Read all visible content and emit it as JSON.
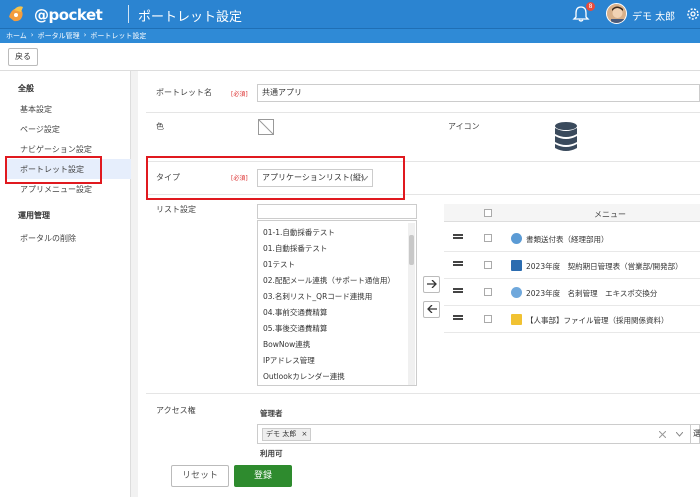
{
  "header": {
    "logo_text": "@pocket",
    "title": "ポートレット設定",
    "notification_count": "8",
    "user_name": "デモ 太郎",
    "colors": {
      "header": "#2b84d1",
      "accent_red": "#e0191f",
      "submit": "#2e8b2e"
    }
  },
  "breadcrumb": [
    "ホーム",
    "›",
    "ポータル管理",
    "›",
    "ポートレット設定"
  ],
  "toolbar": {
    "back_label": "戻る"
  },
  "sidebar": {
    "section1": "全般",
    "items1": [
      "基本設定",
      "ページ設定",
      "ナビゲーション設定",
      "ポートレット設定",
      "アプリメニュー設定"
    ],
    "section2": "運用管理",
    "items2": [
      "ポータルの削除"
    ]
  },
  "form": {
    "portlet_name_label": "ポートレット名",
    "required": "[必須]",
    "portlet_name_value": "共通アプリ",
    "color_label": "色",
    "icon_label": "アイコン",
    "type_label": "タイプ",
    "type_value": "アプリケーションリスト(縦)",
    "list_setting_label": "リスト設定",
    "access_label": "アクセス権",
    "admin_label": "管理者",
    "admin_tag": "デモ 太郎",
    "admin_tag_remove": "×",
    "usable_label": "利用可",
    "select_button_partial": "選"
  },
  "list_items": [
    "01-1.自動採番テスト",
    "01.自動採番テスト",
    "01テスト",
    "02.配配メール連携（サポート通信用）",
    "03.名刺リスト_QRコード連携用",
    "04.事前交通費精算",
    "05.事後交通費精算",
    "BowNow連携",
    "IPアドレス管理",
    "Outlookカレンダー連携"
  ],
  "menu_table": {
    "header": "メニュー",
    "rows": [
      {
        "text": "書類送付表（経理部用）",
        "icon": "globe-icon"
      },
      {
        "text": "2023年度　契約期日管理表（営業部/開発部）",
        "icon": "calendar-icon"
      },
      {
        "text": "2023年度　名刺管理　エキスポ交換分",
        "icon": "cloud-icon"
      },
      {
        "text": "【人事部】ファイル管理（採用関係資料）",
        "icon": "folder-icon"
      }
    ]
  },
  "buttons": {
    "reset": "リセット",
    "submit": "登録"
  }
}
